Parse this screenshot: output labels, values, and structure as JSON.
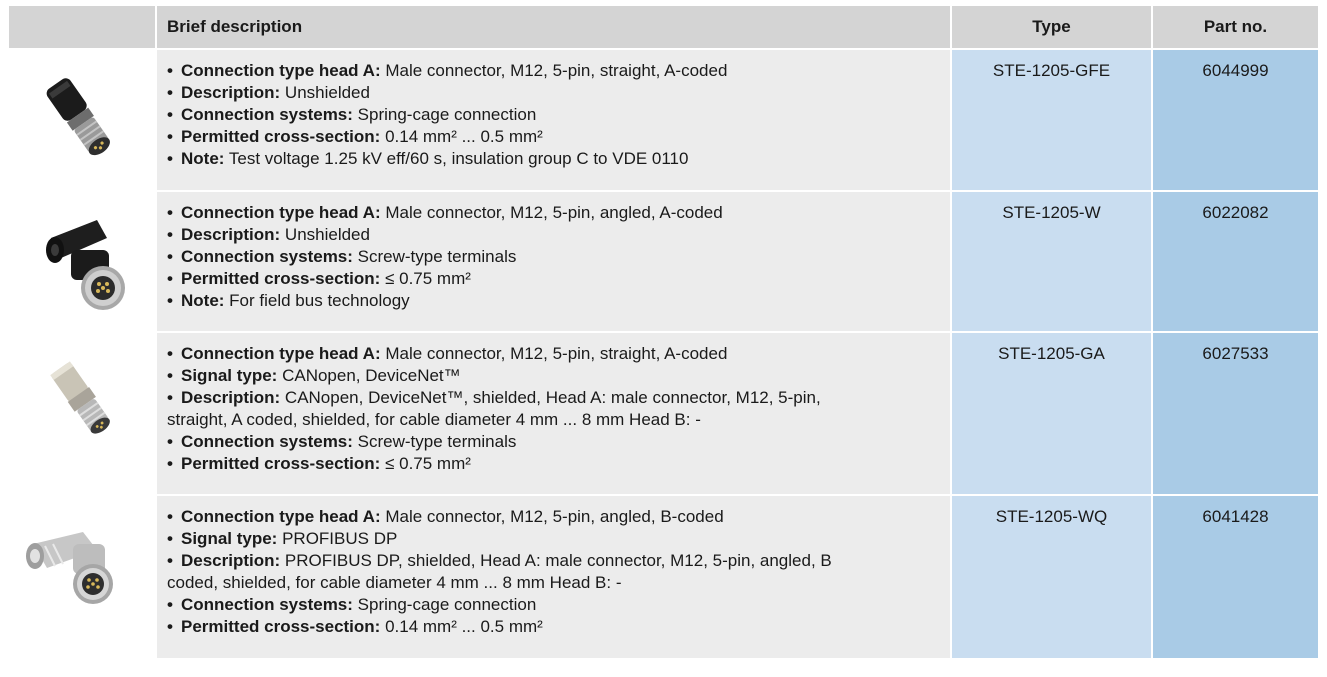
{
  "header": {
    "brief_description": "Brief description",
    "type": "Type",
    "part_no": "Part no."
  },
  "rows": [
    {
      "image": "straight-connector-black-icon",
      "lines": [
        {
          "label": "Connection type head A:",
          "text": " Male connector, M12, 5-pin, straight, A-coded"
        },
        {
          "label": "Description:",
          "text": " Unshielded"
        },
        {
          "label": "Connection systems:",
          "text": " Spring-cage connection"
        },
        {
          "label": "Permitted cross-section:",
          "text": " 0.14 mm² ... 0.5 mm²"
        },
        {
          "label": "Note:",
          "text": " Test voltage 1.25 kV eff/60 s, insulation group C to VDE 0110"
        }
      ],
      "type": "STE-1205-GFE",
      "part_no": "6044999"
    },
    {
      "image": "angled-connector-black-icon",
      "lines": [
        {
          "label": "Connection type head A:",
          "text": " Male connector, M12, 5-pin, angled, A-coded"
        },
        {
          "label": "Description:",
          "text": " Unshielded"
        },
        {
          "label": "Connection systems:",
          "text": " Screw-type terminals"
        },
        {
          "label": "Permitted cross-section:",
          "text": " ≤ 0.75 mm²"
        },
        {
          "label": "Note:",
          "text": " For field bus technology"
        }
      ],
      "type": "STE-1205-W",
      "part_no": "6022082"
    },
    {
      "image": "straight-connector-metal-icon",
      "lines": [
        {
          "label": "Connection type head A:",
          "text": " Male connector, M12, 5-pin, straight, A-coded"
        },
        {
          "label": "Signal type:",
          "text": " CANopen, DeviceNet™"
        },
        {
          "label": "Description:",
          "text": " CANopen, DeviceNet™, shielded, Head A: male connector, M12, 5-pin,",
          "cont": "straight, A coded, shielded, for cable diameter 4 mm ... 8 mm Head B: -"
        },
        {
          "label": "Connection systems:",
          "text": " Screw-type terminals"
        },
        {
          "label": "Permitted cross-section:",
          "text": " ≤ 0.75 mm²"
        }
      ],
      "type": "STE-1205-GA",
      "part_no": "6027533"
    },
    {
      "image": "angled-connector-metal-icon",
      "lines": [
        {
          "label": "Connection type head A:",
          "text": " Male connector, M12, 5-pin, angled, B-coded"
        },
        {
          "label": "Signal type:",
          "text": " PROFIBUS DP"
        },
        {
          "label": "Description:",
          "text": " PROFIBUS DP, shielded, Head A: male connector, M12, 5-pin, angled, B",
          "cont": "coded, shielded, for cable diameter 4 mm ... 8 mm Head B: -"
        },
        {
          "label": "Connection systems:",
          "text": " Spring-cage connection"
        },
        {
          "label": "Permitted cross-section:",
          "text": " 0.14 mm² ... 0.5 mm²"
        }
      ],
      "type": "STE-1205-WQ",
      "part_no": "6041428"
    }
  ]
}
